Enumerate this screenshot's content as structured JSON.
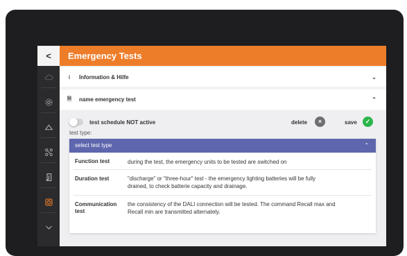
{
  "sidebar": {
    "back_label": "<",
    "icons": [
      "cloud-icon",
      "settings-icon",
      "alarm-icon",
      "network-icon",
      "exit-icon",
      "emergency-timer-icon",
      "chevron-down-icon"
    ],
    "active_color": "#ee7d2a"
  },
  "header": {
    "title": "Emergency Tests",
    "color": "#ee7d2a"
  },
  "sections": {
    "info": {
      "icon": "i",
      "label": "Information & Hilfe",
      "chevron": "⌄"
    },
    "name_test": {
      "icon": "🗎",
      "label": "name emergency test",
      "chevron": "⌃"
    }
  },
  "schedule": {
    "toggle_label": "test schedule NOT active",
    "toggle_on": false,
    "delete_label": "delete",
    "delete_icon": "×",
    "save_label": "save",
    "save_icon": "✓"
  },
  "test_type": {
    "label": "test type:",
    "placeholder": "select test type",
    "chevron": "⌃",
    "options": [
      {
        "name": "Function test",
        "description": "during the test, the emergency units to be tested are switched on"
      },
      {
        "name": "Duration test",
        "description": "\"discharge\" or \"three-hour\" test - the emergency lighting batteries will be fully drained, to check batterie capacity and drainage."
      },
      {
        "name": "Communication test",
        "description": "the consistency of the DALI connection will be tested. The command Recall max and Recall min are transmitted alternately."
      }
    ]
  },
  "colors": {
    "dropdown_header": "#5e66ad",
    "delete": "#6d6d72",
    "save": "#2bb54a"
  }
}
